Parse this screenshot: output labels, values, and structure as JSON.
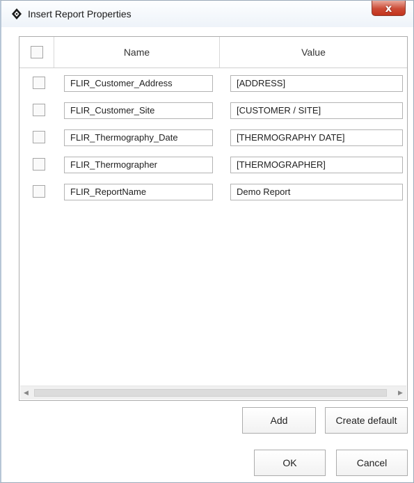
{
  "window": {
    "title": "Insert Report Properties",
    "close_label": "x"
  },
  "grid": {
    "columns": {
      "name": "Name",
      "value": "Value"
    },
    "rows": [
      {
        "name": "FLIR_Customer_Address",
        "value": "[ADDRESS]",
        "checked": false
      },
      {
        "name": "FLIR_Customer_Site",
        "value": "[CUSTOMER / SITE]",
        "checked": false
      },
      {
        "name": "FLIR_Thermography_Date",
        "value": "[THERMOGRAPHY DATE]",
        "checked": false
      },
      {
        "name": "FLIR_Thermographer",
        "value": "[THERMOGRAPHER]",
        "checked": false
      },
      {
        "name": "FLIR_ReportName",
        "value": "Demo Report",
        "checked": false
      }
    ]
  },
  "buttons": {
    "add": "Add",
    "create_default": "Create default",
    "ok": "OK",
    "cancel": "Cancel"
  }
}
